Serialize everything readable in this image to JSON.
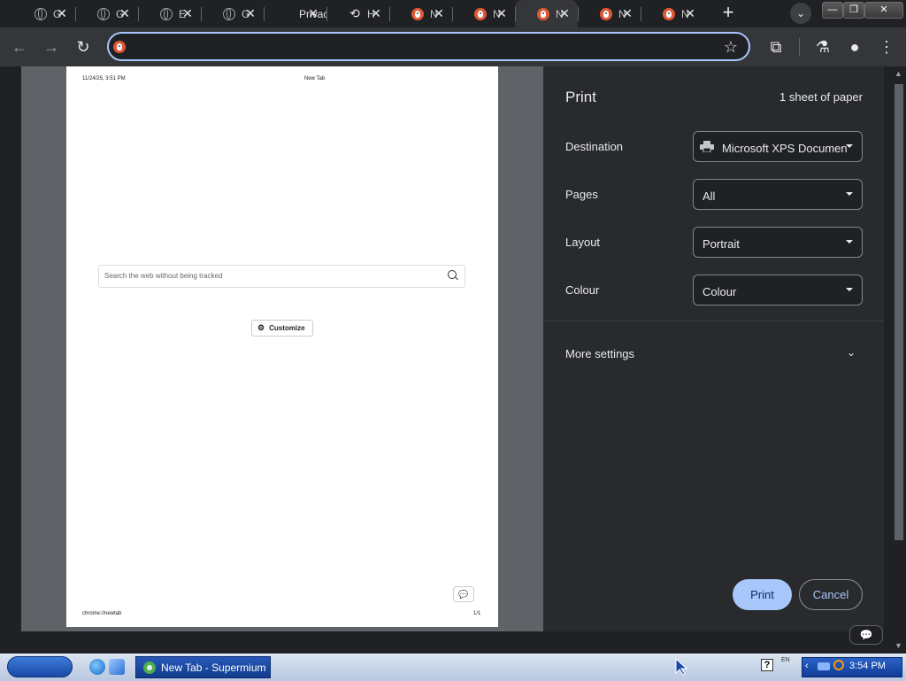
{
  "tabs": [
    {
      "icon": "globe-icon",
      "title": "G",
      "close": "✕"
    },
    {
      "icon": "globe-icon",
      "title": "G",
      "close": "✕"
    },
    {
      "icon": "globe-icon",
      "title": "E",
      "close": "✕"
    },
    {
      "icon": "globe-icon",
      "title": "G",
      "close": "✕"
    },
    {
      "icon": "none",
      "title": "Privacy",
      "close": "✕"
    },
    {
      "icon": "history-icon",
      "title": "H",
      "close": "✕"
    },
    {
      "icon": "duckduckgo-icon",
      "title": "N",
      "close": "✕"
    },
    {
      "icon": "duckduckgo-icon",
      "title": "N",
      "close": "✕"
    },
    {
      "icon": "duckduckgo-icon",
      "title": "N",
      "close": "✕"
    },
    {
      "icon": "duckduckgo-icon",
      "title": "N",
      "close": "✕"
    },
    {
      "icon": "duckduckgo-icon",
      "title": "N",
      "close": "✕"
    }
  ],
  "tabstrip": {
    "new_tab": "+",
    "tab_search": "⌄"
  },
  "window_controls": {
    "minimize": "—",
    "maximize": "❐",
    "close": "✕"
  },
  "toolbar": {
    "back": "←",
    "forward": "→",
    "reload": "↻",
    "bookmark": "☆",
    "extensions": "⧉",
    "labs": "⚗",
    "profile": "●",
    "menu": "⋮",
    "address_value": ""
  },
  "preview_page": {
    "header_left": "11/24/25, 3:51 PM",
    "header_center": "New Tab",
    "search_placeholder": "Search the web without being tracked",
    "customize_label": "Customize",
    "footer_left": "chrome://newtab",
    "footer_right": "1/1"
  },
  "print_panel": {
    "title": "Print",
    "sheet_count": "1 sheet of paper",
    "destination_label": "Destination",
    "destination_value": "Microsoft XPS Documen",
    "pages_label": "Pages",
    "pages_value": "All",
    "layout_label": "Layout",
    "layout_value": "Portrait",
    "colour_label": "Colour",
    "colour_value": "Colour",
    "more_settings": "More settings",
    "print_button": "Print",
    "cancel_button": "Cancel"
  },
  "taskbar": {
    "task_item": "New Tab - Supermium",
    "clock": "3:54 PM",
    "help": "?",
    "lang": "EN"
  },
  "colors": {
    "accent": "#a8c7fa",
    "panel_bg": "#292a2d",
    "ddg_orange": "#de5833"
  }
}
